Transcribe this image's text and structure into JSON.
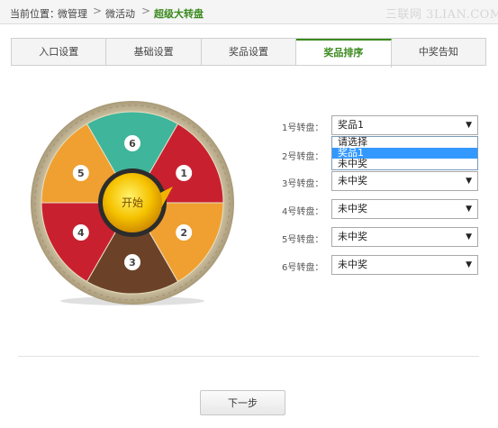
{
  "breadcrumb": {
    "prefix": "当前位置：",
    "items": [
      "微管理",
      "微活动",
      "超级大转盘"
    ],
    "separator": ">"
  },
  "watermark": "三联网 3LIAN.COM",
  "tabs": [
    {
      "label": "入口设置",
      "active": false
    },
    {
      "label": "基础设置",
      "active": false
    },
    {
      "label": "奖品设置",
      "active": false
    },
    {
      "label": "奖品排序",
      "active": true
    },
    {
      "label": "中奖告知",
      "active": false
    }
  ],
  "wheel": {
    "start_label": "开始",
    "segments": [
      {
        "number": "6",
        "color": "#3fb59b"
      },
      {
        "number": "1",
        "color": "#c9202f"
      },
      {
        "number": "2",
        "color": "#f0a030"
      },
      {
        "number": "3",
        "color": "#6b4228"
      },
      {
        "number": "4",
        "color": "#c9202f"
      },
      {
        "number": "5",
        "color": "#f0a030"
      }
    ]
  },
  "rows": [
    {
      "label": "1号转盘：",
      "value": "奖品1"
    },
    {
      "label": "2号转盘：",
      "value": "未中奖"
    },
    {
      "label": "3号转盘：",
      "value": "未中奖"
    },
    {
      "label": "4号转盘：",
      "value": "未中奖"
    },
    {
      "label": "5号转盘：",
      "value": "未中奖"
    },
    {
      "label": "6号转盘：",
      "value": "未中奖"
    }
  ],
  "dropdown": {
    "options": [
      {
        "label": "请选择",
        "selected": false
      },
      {
        "label": "奖品1",
        "selected": true
      },
      {
        "label": "未中奖",
        "selected": false
      }
    ]
  },
  "next_button": "下一步",
  "colors": {
    "accent": "#3a8a1e",
    "dropdown_highlight": "#3399ff"
  }
}
